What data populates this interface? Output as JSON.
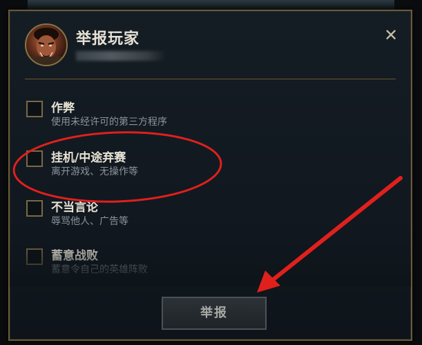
{
  "dialog": {
    "title": "举报玩家",
    "close_label": "✕",
    "options": [
      {
        "title": "作弊",
        "desc": "使用未经许可的第三方程序"
      },
      {
        "title": "挂机/中途弃赛",
        "desc": "离开游戏、无操作等"
      },
      {
        "title": "不当言论",
        "desc": "辱骂他人、广告等"
      },
      {
        "title": "蓄意战败",
        "desc": "蓄意令自己的英雄阵败"
      }
    ],
    "report_label": "举报"
  },
  "colors": {
    "border_gold": "#6b5a34",
    "annotation_red": "#e0201c",
    "text_primary": "#e8e3d4",
    "text_secondary": "#8d949a"
  },
  "icons": {
    "close": "close-icon",
    "avatar": "champion-portrait"
  }
}
